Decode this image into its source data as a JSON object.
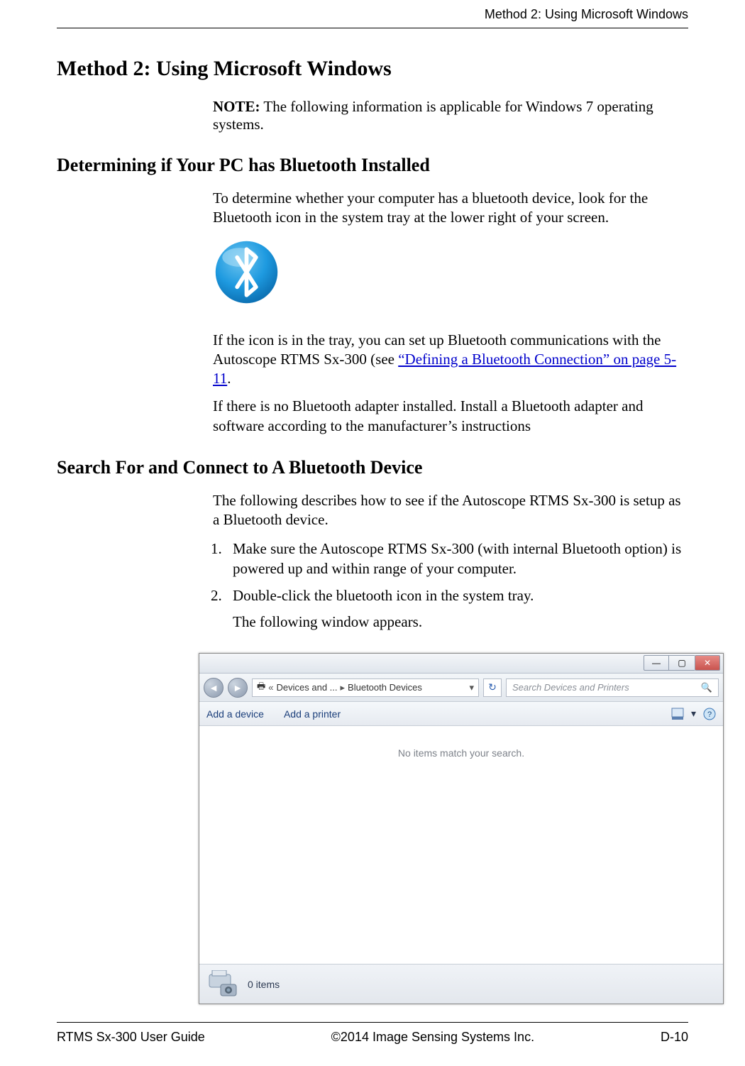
{
  "header": {
    "section_title": "Method 2: Using Microsoft Windows"
  },
  "h1": "Method 2: Using Microsoft Windows",
  "note": {
    "label": "NOTE:",
    "text": "The following information is applicable for Windows 7 operating systems."
  },
  "section1": {
    "heading": "Determining if Your PC has Bluetooth Installed",
    "p1": "To determine whether your computer has a bluetooth device, look for the Bluetooth icon in the system tray at the lower right of your screen.",
    "p2_pre": "If the icon is in the tray, you can set up Bluetooth communications with the Autoscope RTMS Sx-300 (see ",
    "p2_link": "“Defining a Bluetooth Connection” on page 5-11",
    "p2_post": ".",
    "p3": "If there is no Bluetooth adapter installed. Install a Bluetooth adapter and software according to the manufacturer’s instructions"
  },
  "section2": {
    "heading": "Search For and Connect to A Bluetooth Device",
    "intro": "The following describes how to see if the Autoscope RTMS Sx-300 is setup as a Bluetooth device.",
    "steps": [
      "Make sure the Autoscope RTMS Sx-300 (with internal Bluetooth option) is powered up and within range of your computer.",
      "Double-click the bluetooth icon in the system tray."
    ],
    "step2_sub": "The following window appears."
  },
  "window": {
    "breadcrumb": {
      "prefix": "«",
      "part1": "Devices and ...",
      "part2": "Bluetooth Devices"
    },
    "search_placeholder": "Search Devices and Printers",
    "toolbar": {
      "add_device": "Add a device",
      "add_printer": "Add a printer"
    },
    "empty_message": "No items match your search.",
    "status": "0 items"
  },
  "footer": {
    "left": "RTMS Sx-300 User Guide",
    "center": "©2014 Image Sensing Systems Inc.",
    "right": "D-10"
  }
}
